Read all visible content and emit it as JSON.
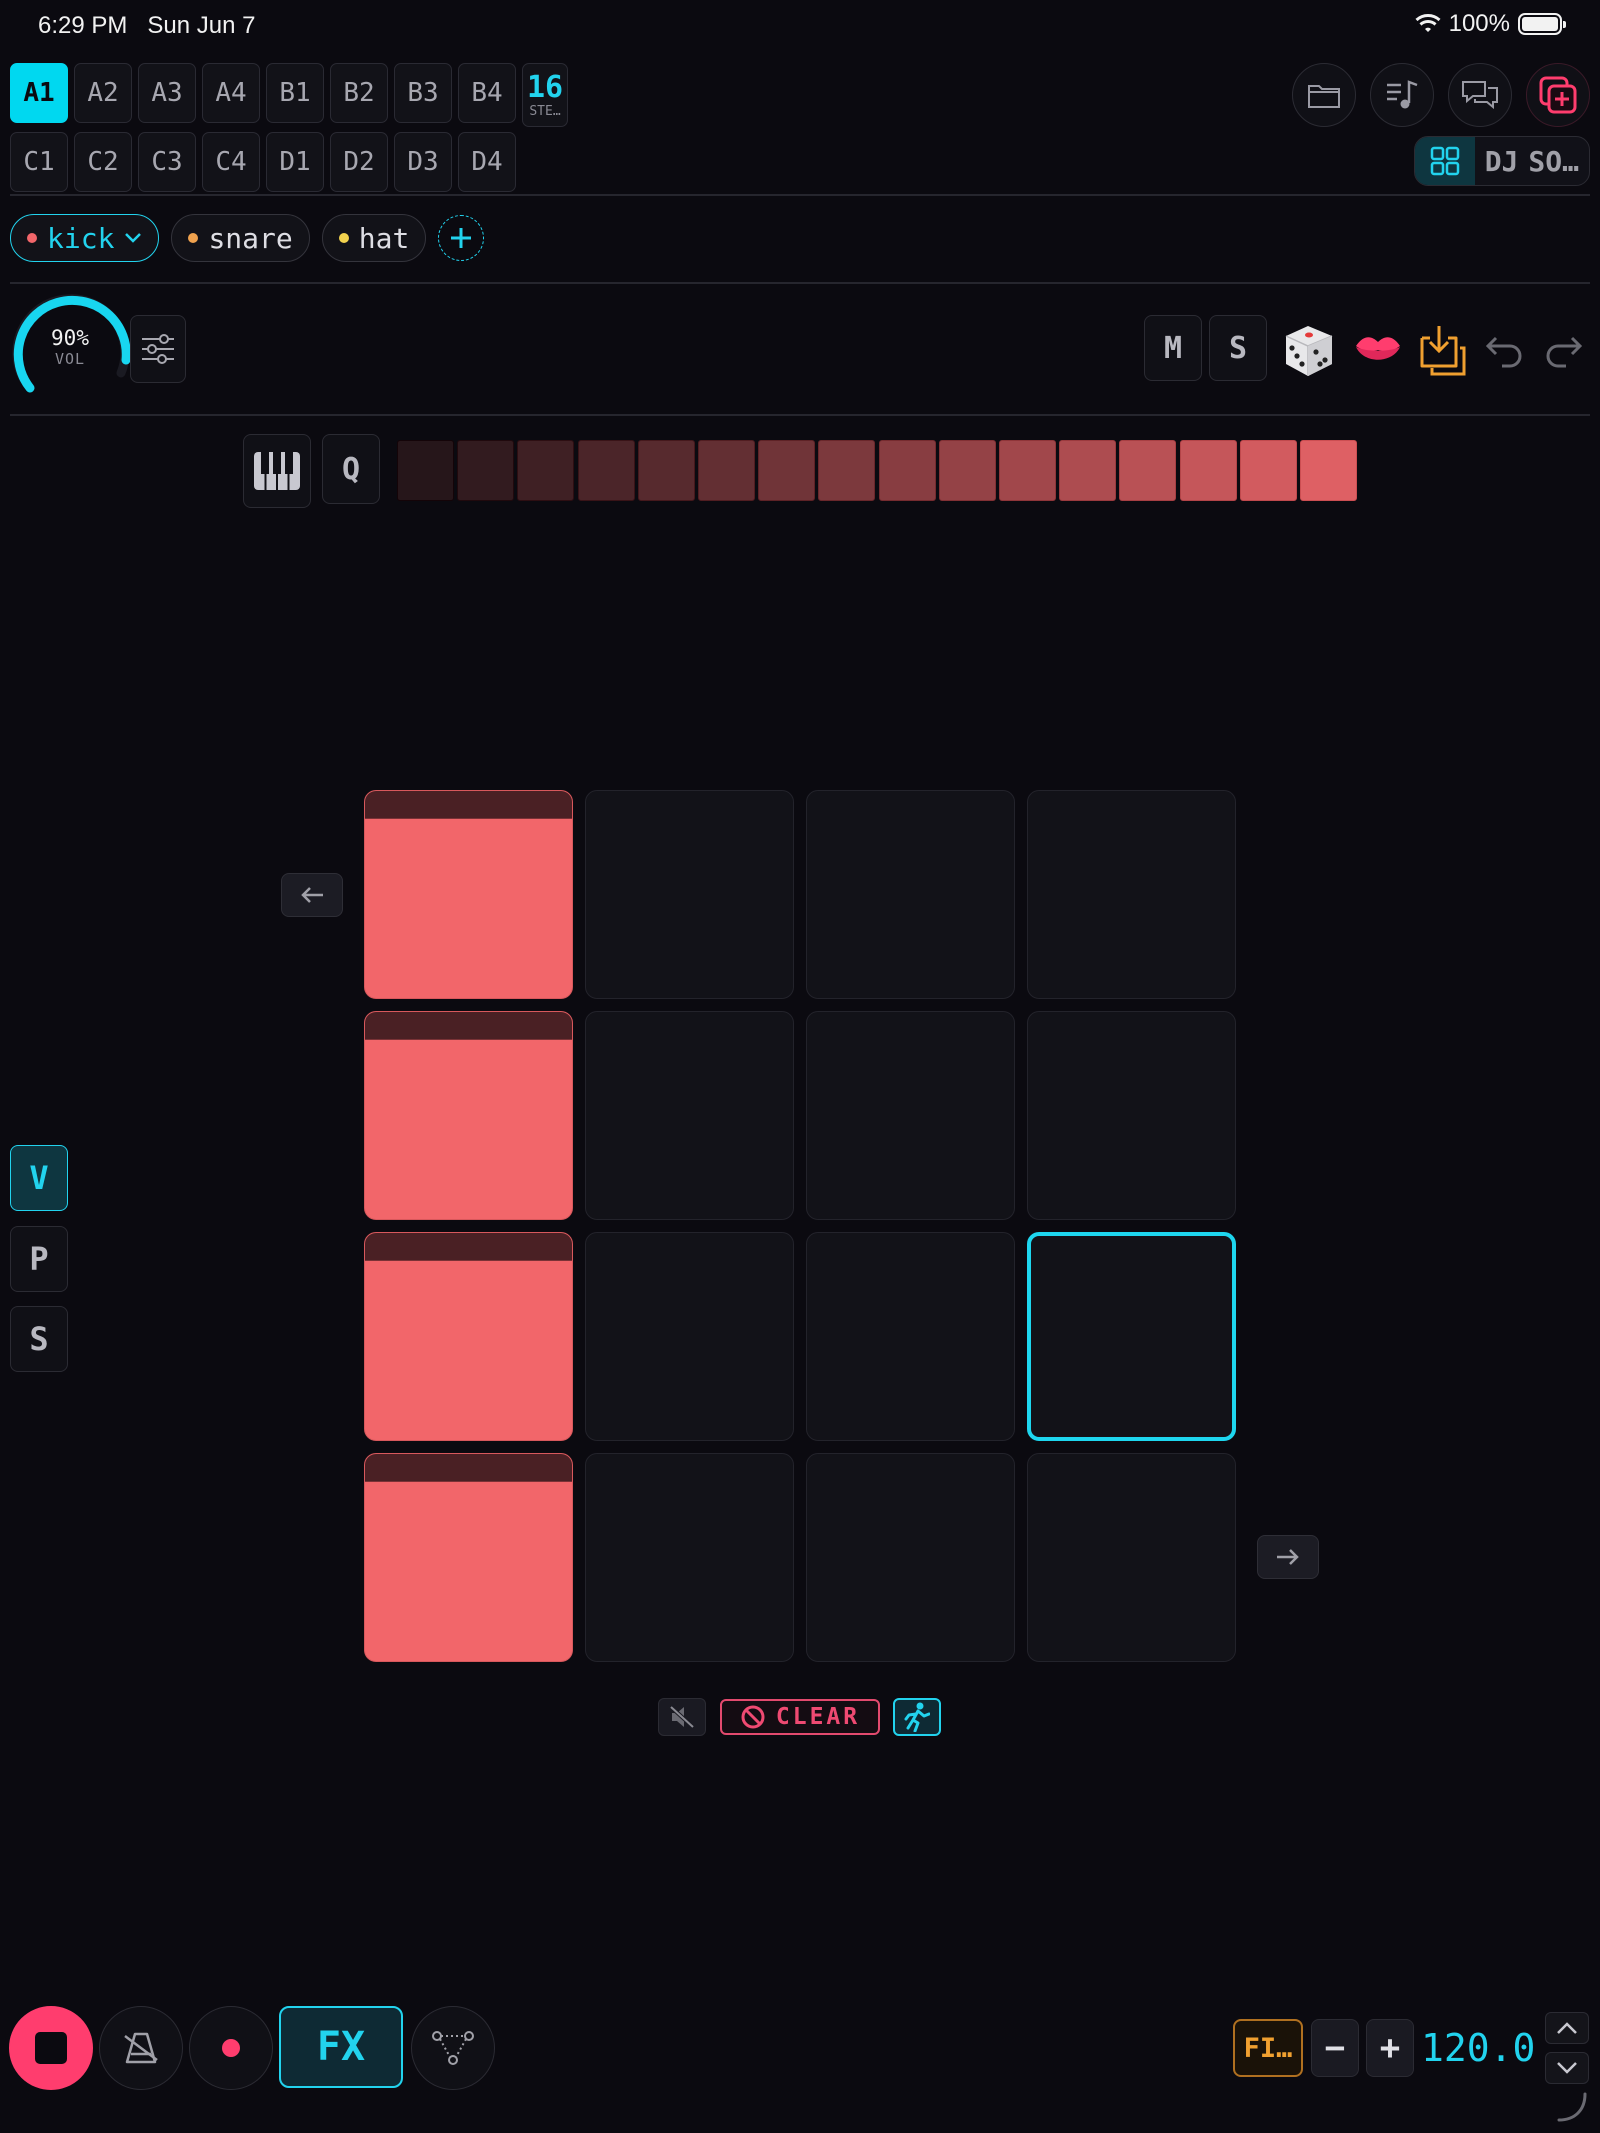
{
  "status": {
    "time": "6:29 PM",
    "date": "Sun Jun 7",
    "battery": "100%"
  },
  "patterns": {
    "row1": [
      "A1",
      "A2",
      "A3",
      "A4",
      "B1",
      "B2",
      "B3",
      "B4"
    ],
    "row2": [
      "C1",
      "C2",
      "C3",
      "C4",
      "D1",
      "D2",
      "D3",
      "D4"
    ],
    "active": "A1",
    "steps_value": "16",
    "steps_label": "STE…"
  },
  "view_modes": {
    "dj": "DJ",
    "song": "SO…"
  },
  "instruments": [
    {
      "name": "kick",
      "color": "#f2666a"
    },
    {
      "name": "snare",
      "color": "#f0a24e"
    },
    {
      "name": "hat",
      "color": "#f2d24e"
    }
  ],
  "volume": {
    "value": "90%",
    "label": "VOL",
    "fraction": 0.9
  },
  "track_buttons": {
    "mute": "M",
    "solo": "S"
  },
  "velocity_bar": {
    "quantize": "Q",
    "levels": 16
  },
  "sidebar_modes": {
    "velocity": "V",
    "pitch": "P",
    "swing": "S"
  },
  "pads": {
    "rows": 4,
    "cols": 4,
    "active_col": 0,
    "focused": [
      2,
      3
    ]
  },
  "actions": {
    "clear": "CLEAR"
  },
  "transport": {
    "fx": "FX",
    "fill": "FI…",
    "minus": "−",
    "plus": "+",
    "tempo": "120.0"
  },
  "colors": {
    "accent": "#22d3ee",
    "pad_on": "#f2666a",
    "record": "#ff3d6e",
    "warn": "#f0a030"
  }
}
